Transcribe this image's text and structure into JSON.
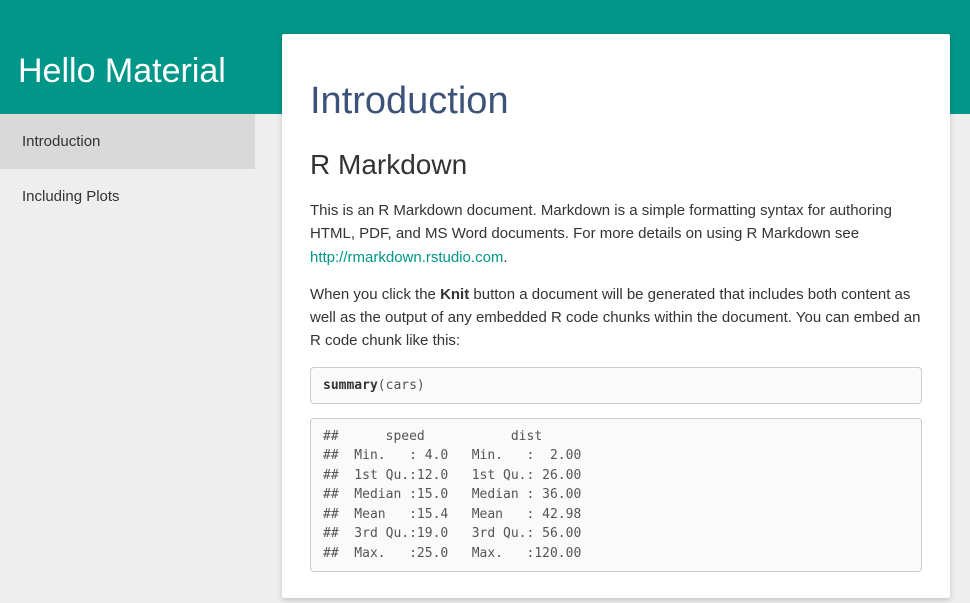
{
  "header": {
    "title": "Hello Material"
  },
  "sidebar": {
    "items": [
      {
        "label": "Introduction",
        "active": true
      },
      {
        "label": "Including Plots",
        "active": false
      }
    ]
  },
  "content": {
    "title": "Introduction",
    "section_title": "R Markdown",
    "para1_a": "This is an R Markdown document. Markdown is a simple formatting syntax for authoring HTML, PDF, and MS Word documents. For more details on using R Markdown see ",
    "para1_link_text": "http://rmarkdown.rstudio.com",
    "para1_b": ".",
    "para2_a": "When you click the ",
    "para2_bold": "Knit",
    "para2_b": " button a document will be generated that includes both content as well as the output of any embedded R code chunks within the document. You can embed an R code chunk like this:",
    "code_fn": "summary",
    "code_rest": "(cars)",
    "output": "##      speed           dist       \n##  Min.   : 4.0   Min.   :  2.00  \n##  1st Qu.:12.0   1st Qu.: 26.00  \n##  Median :15.0   Median : 36.00  \n##  Mean   :15.4   Mean   : 42.98  \n##  3rd Qu.:19.0   3rd Qu.: 56.00  \n##  Max.   :25.0   Max.   :120.00"
  }
}
